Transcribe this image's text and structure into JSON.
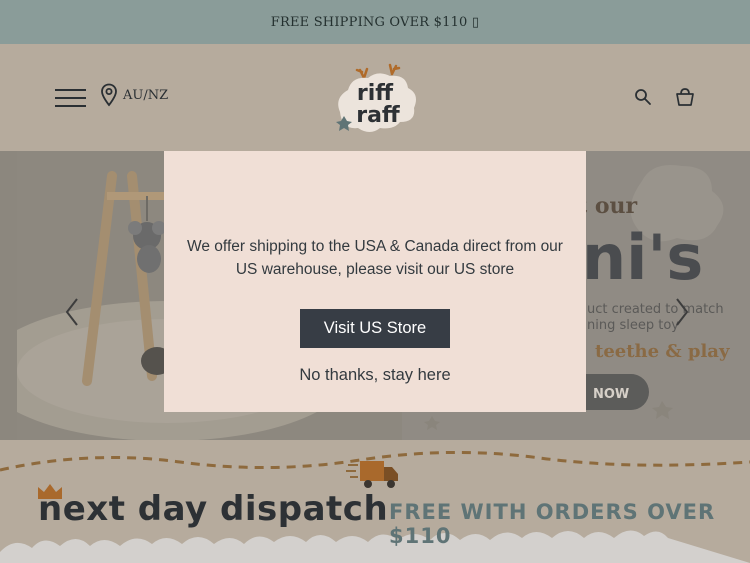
{
  "announcement": {
    "text": "FREE SHIPPING OVER $110 ▯"
  },
  "header": {
    "location_label": "AU/NZ",
    "logo_text": "riff raff"
  },
  "hero": {
    "partial_text_lines": [
      "t our",
      "ni's",
      "uct created to match",
      "ning sleep toy",
      "teethe & play",
      "NOW"
    ]
  },
  "modal": {
    "message": "We offer shipping to the USA & Canada direct from our US warehouse, please visit our US store",
    "visit_button": "Visit US Store",
    "stay_link": "No thanks, stay here"
  },
  "dispatch_banner": {
    "headline": "next day dispatch",
    "subline": "FREE WITH ORDERS OVER $110"
  },
  "colors": {
    "announcement_bg": "#8a9c99",
    "header_bg": "#b6ab9d",
    "modal_bg": "#f0dfd6",
    "button_bg": "#373d45",
    "accent_teal": "#5f7476",
    "accent_orange": "#b06b2a"
  }
}
